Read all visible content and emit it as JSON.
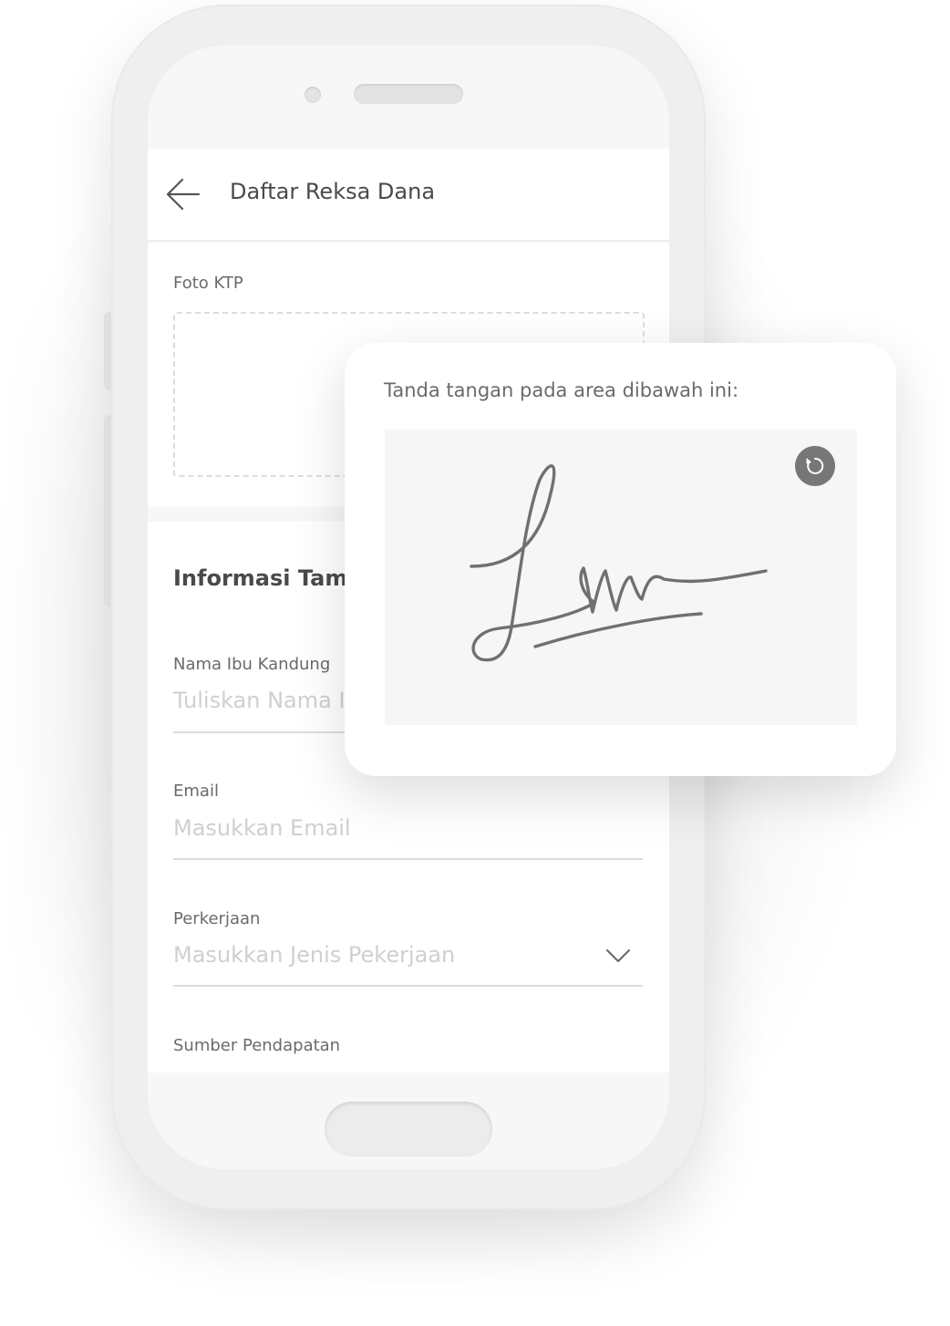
{
  "appbar": {
    "title": "Daftar Reksa Dana",
    "back_icon": "arrow-left-icon"
  },
  "form": {
    "photo_label": "Foto KTP",
    "section_heading": "Informasi Tamb",
    "mother_name": {
      "label": "Nama Ibu Kandung",
      "placeholder": "Tuliskan Nama I"
    },
    "email": {
      "label": "Email",
      "placeholder": "Masukkan Email"
    },
    "job": {
      "label": "Perkerjaan",
      "placeholder": "Masukkan Jenis Pekerjaan",
      "dropdown_icon": "chevron-down-icon"
    },
    "income_source": {
      "label": "Sumber Pendapatan"
    }
  },
  "signature_card": {
    "instruction": "Tanda tangan pada area dibawah ini:",
    "reset_icon": "refresh-icon"
  },
  "colors": {
    "background": "#ffffff",
    "phone_body": "#efefef",
    "screen": "#f7f7f7",
    "text_primary": "#4a4a4a",
    "text_secondary": "#6a6a6a",
    "placeholder": "#cfcfcf",
    "signature_ink": "#707070"
  }
}
